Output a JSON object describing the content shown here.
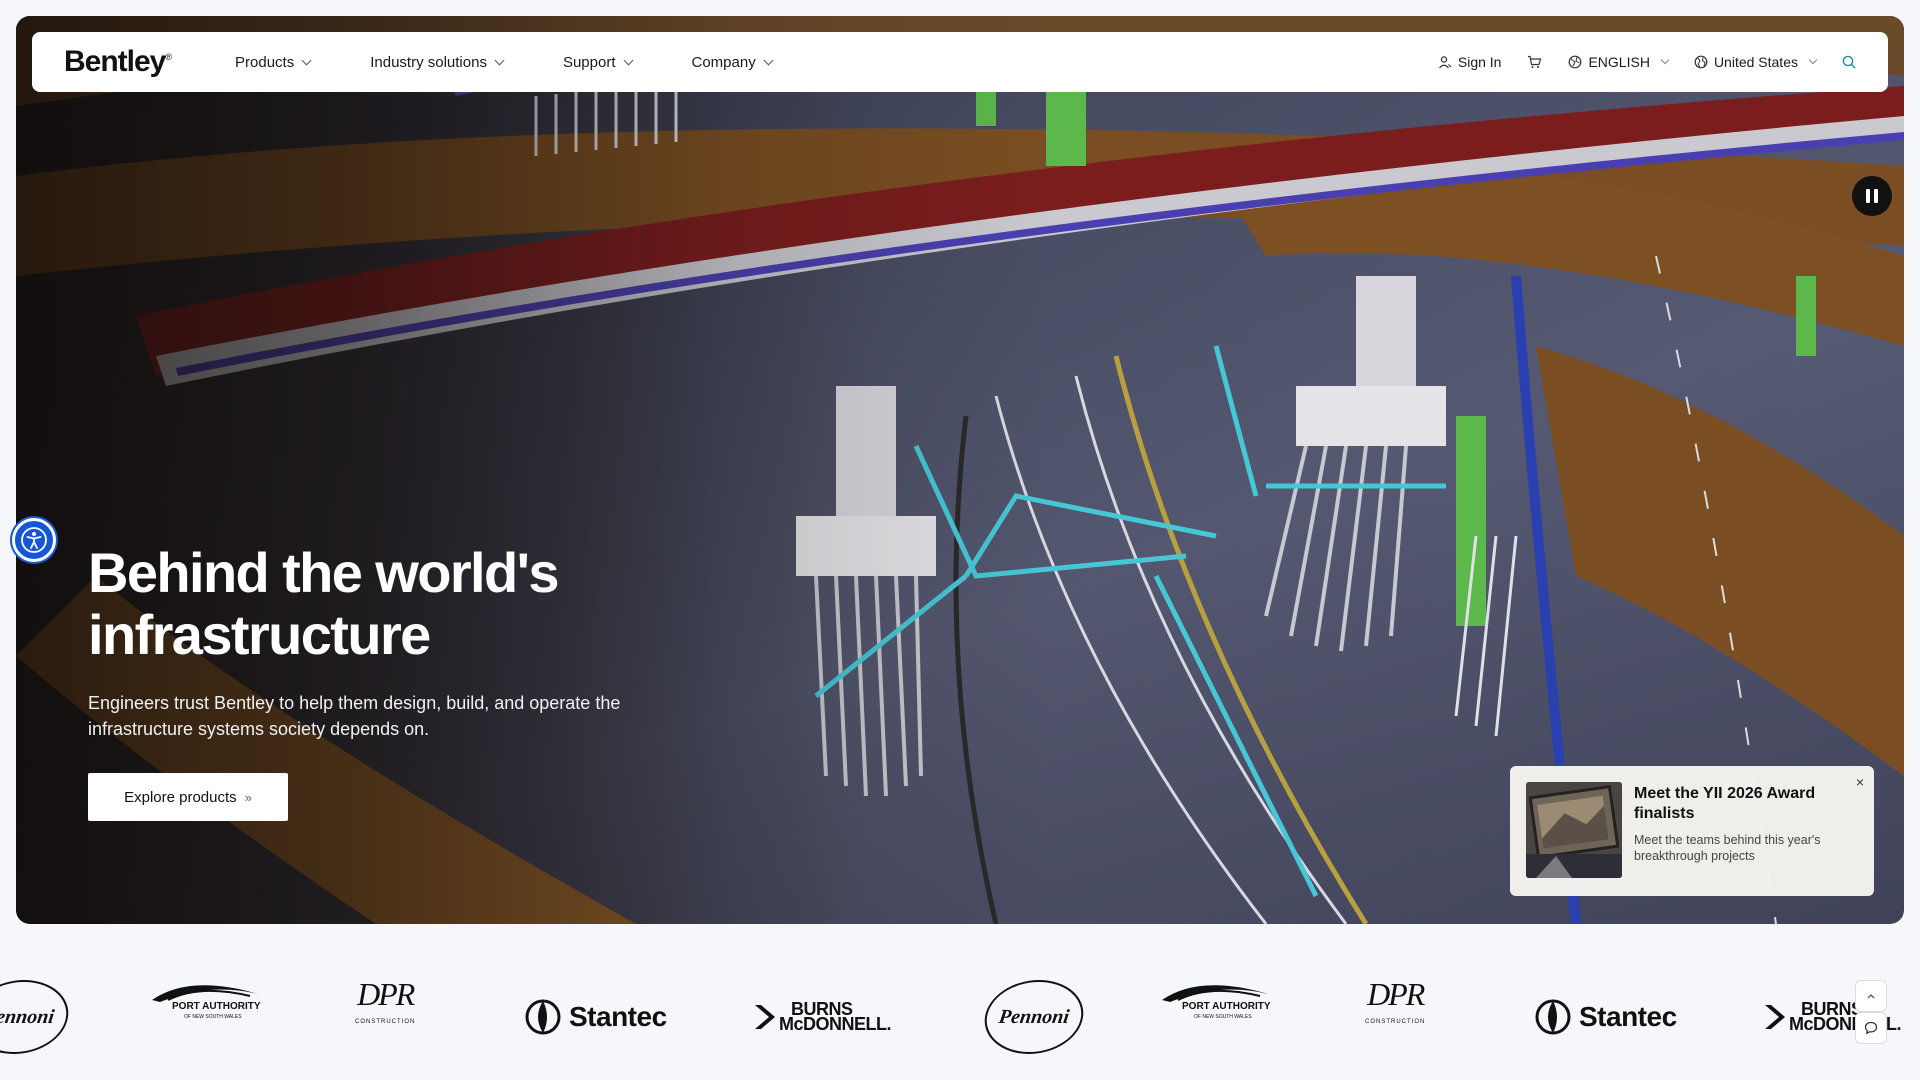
{
  "nav": {
    "logo": "Bentley",
    "menu": [
      {
        "label": "Products"
      },
      {
        "label": "Industry solutions"
      },
      {
        "label": "Support"
      },
      {
        "label": "Company"
      }
    ],
    "sign_in": "Sign In",
    "language": "ENGLISH",
    "region": "United States"
  },
  "hero": {
    "headline_line1": "Behind the world's",
    "headline_line2": "infrastructure",
    "subtitle_line1": "Engineers trust Bentley to help them design, build, and operate the",
    "subtitle_line2": "infrastructure systems society depends on.",
    "cta_label": "Explore products",
    "cta_arrows": "»"
  },
  "promo": {
    "title": "Meet the YII 2026 Award finalists",
    "description": "Meet the teams behind this year's breakthrough projects",
    "close": "×"
  },
  "logos": {
    "pennoni": "Pennoni",
    "port_authority": "PORT AUTHORITY",
    "port_authority_sub": "OF NEW SOUTH WALES",
    "dpr": "DPR",
    "dpr_sub": "CONSTRUCTION",
    "stantec": "Stantec",
    "burns1": "BURNS",
    "burns2": "McDONNELL."
  },
  "colors": {
    "accent_blue": "#1557d6",
    "nav_bg": "#ffffff",
    "hero_text": "#ffffff"
  }
}
